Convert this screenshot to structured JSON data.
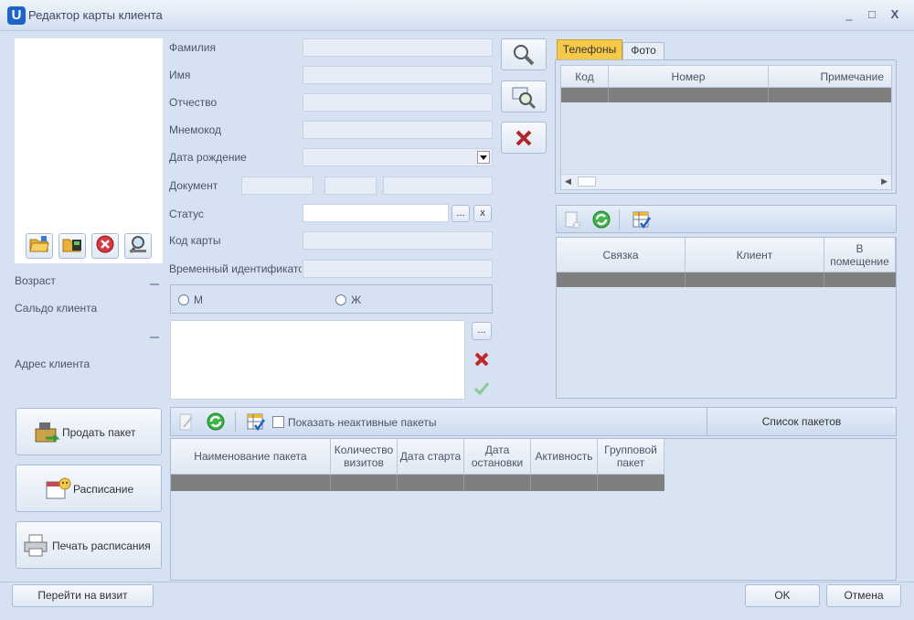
{
  "window": {
    "logo": "U",
    "title": "Редактор карты клиента",
    "minimize": "_",
    "maximize": "□",
    "close": "X"
  },
  "colors": {
    "accent": "#1e63c8",
    "tab_active": "#f7c948",
    "delete_red": "#c0262c",
    "ok_green": "#3e9e3e",
    "refresh_green": "#2ea043"
  },
  "form": {
    "surname": {
      "label": "Фамилия",
      "value": ""
    },
    "name": {
      "label": "Имя",
      "value": ""
    },
    "patronymic": {
      "label": "Отчество",
      "value": ""
    },
    "mnemocode": {
      "label": "Мнемокод",
      "value": ""
    },
    "birthdate": {
      "label": "Дата рождение",
      "value": ""
    },
    "document": {
      "label": "Документ",
      "part1": "",
      "part2": "",
      "part3": ""
    },
    "status": {
      "label": "Статус",
      "value": "",
      "browse": "...",
      "clear": "x"
    },
    "card_code": {
      "label": "Код карты",
      "value": ""
    },
    "temp_id": {
      "label": "Временный идентификатор",
      "value": ""
    },
    "gender": {
      "male": "М",
      "female": "Ж"
    },
    "address_browse": "..."
  },
  "left": {
    "age_label": "Возраст",
    "balance_label": "Сальдо клиента",
    "address_label": "Адрес клиента",
    "sell_package": "Продать пакет",
    "schedule": "Расписание",
    "print_schedule": "Печать расписания",
    "goto_visit": "Перейти на визит"
  },
  "phones": {
    "tabs": [
      "Телефоны",
      "Фото"
    ],
    "columns": [
      "Код",
      "Номер",
      "Примечание"
    ]
  },
  "relations": {
    "columns": [
      "Связка",
      "Клиент",
      "В помещение"
    ]
  },
  "packages": {
    "show_inactive": "Показать неактивные пакеты",
    "list_button": "Список пакетов",
    "columns": [
      "Наименование пакета",
      "Количество визитов",
      "Дата старта",
      "Дата остановки",
      "Активность",
      "Групповой пакет"
    ]
  },
  "footer": {
    "ok": "OK",
    "cancel": "Отмена"
  }
}
